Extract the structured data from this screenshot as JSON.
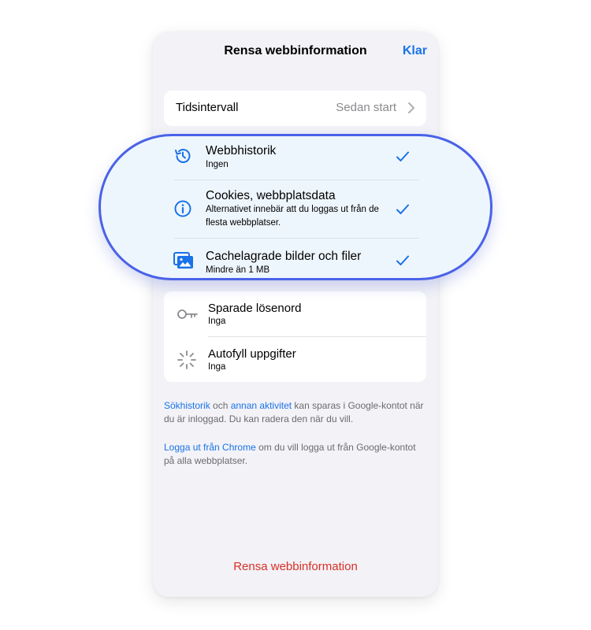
{
  "header": {
    "title": "Rensa webbinformation",
    "done_label": "Klar"
  },
  "time_range": {
    "label": "Tidsintervall",
    "value": "Sedan start"
  },
  "selected_items": [
    {
      "title": "Webbhistorik",
      "subtitle": "Ingen",
      "icon": "history-icon",
      "checked": true
    },
    {
      "title": "Cookies, webbplatsdata",
      "subtitle": "Alternativet innebär att du loggas ut från de flesta webbplatser.",
      "icon": "info-icon",
      "checked": true
    },
    {
      "title": "Cachelagrade bilder och filer",
      "subtitle": "Mindre än 1 MB",
      "icon": "images-icon",
      "checked": true
    }
  ],
  "other_items": [
    {
      "title": "Sparade lösenord",
      "subtitle": "Inga",
      "icon": "key-icon"
    },
    {
      "title": "Autofyll uppgifter",
      "subtitle": "Inga",
      "icon": "autofill-icon"
    }
  ],
  "footer": {
    "p1_link1": "Sökhistorik",
    "p1_mid": " och ",
    "p1_link2": "annan aktivitet",
    "p1_rest": " kan sparas i Google-kontot när du är inloggad. Du kan radera den när du vill.",
    "p2_link": "Logga ut från Chrome",
    "p2_rest": " om du vill logga ut från Google-kontot på alla webbplatser."
  },
  "clear_button_label": "Rensa webbinformation",
  "colors": {
    "accent": "#1a73e8",
    "destructive": "#d93025",
    "highlight_border": "#4a62e8"
  }
}
